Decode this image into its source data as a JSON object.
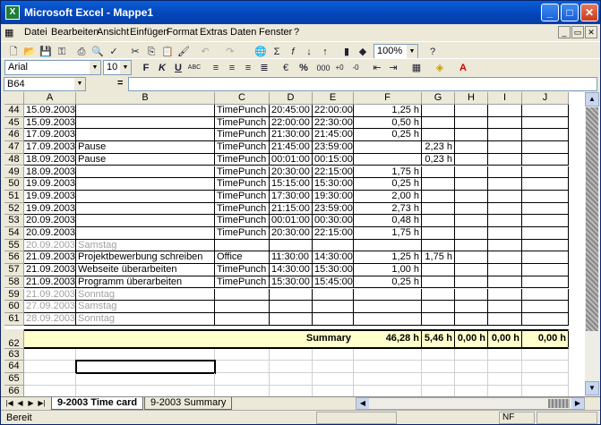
{
  "window": {
    "title": "Microsoft Excel - Mappe1",
    "app_icon": "X"
  },
  "menu": [
    "Datei",
    "Bearbeiten",
    "Ansicht",
    "Einfügen",
    "Format",
    "Extras",
    "Daten",
    "Fenster",
    "?"
  ],
  "toolbar": {
    "zoom": "100%",
    "font": "Arial",
    "size": "10",
    "bold": "F",
    "italic": "K",
    "underline": "U",
    "currency": "€",
    "percent": "%",
    "thousands": "000"
  },
  "formula": {
    "namebox": "B64",
    "eq": "=",
    "content": ""
  },
  "columns": [
    "A",
    "B",
    "C",
    "D",
    "E",
    "F",
    "G",
    "H",
    "I",
    "J"
  ],
  "rows": [
    {
      "n": "44",
      "a": "15.09.2003",
      "b": "",
      "c": "TimePunch",
      "d": "20:45:00",
      "e": "22:00:00",
      "f": "1,25 h",
      "g": "",
      "gray": false
    },
    {
      "n": "45",
      "a": "15.09.2003",
      "b": "",
      "c": "TimePunch",
      "d": "22:00:00",
      "e": "22:30:00",
      "f": "0,50 h",
      "g": "",
      "gray": false
    },
    {
      "n": "46",
      "a": "17.09.2003",
      "b": "",
      "c": "TimePunch",
      "d": "21:30:00",
      "e": "21:45:00",
      "f": "0,25 h",
      "g": "",
      "gray": false
    },
    {
      "n": "47",
      "a": "17.09.2003",
      "b": "Pause",
      "c": "TimePunch",
      "d": "21:45:00",
      "e": "23:59:00",
      "f": "",
      "g": "2,23 h",
      "gray": false
    },
    {
      "n": "48",
      "a": "18.09.2003",
      "b": "Pause",
      "c": "TimePunch",
      "d": "00:01:00",
      "e": "00:15:00",
      "f": "",
      "g": "0,23 h",
      "gray": false
    },
    {
      "n": "49",
      "a": "18.09.2003",
      "b": "",
      "c": "TimePunch",
      "d": "20:30:00",
      "e": "22:15:00",
      "f": "1,75 h",
      "g": "",
      "gray": false
    },
    {
      "n": "50",
      "a": "19.09.2003",
      "b": "",
      "c": "TimePunch",
      "d": "15:15:00",
      "e": "15:30:00",
      "f": "0,25 h",
      "g": "",
      "gray": false
    },
    {
      "n": "51",
      "a": "19.09.2003",
      "b": "",
      "c": "TimePunch",
      "d": "17:30:00",
      "e": "19:30:00",
      "f": "2,00 h",
      "g": "",
      "gray": false
    },
    {
      "n": "52",
      "a": "19.09.2003",
      "b": "",
      "c": "TimePunch",
      "d": "21:15:00",
      "e": "23:59:00",
      "f": "2,73 h",
      "g": "",
      "gray": false
    },
    {
      "n": "53",
      "a": "20.09.2003",
      "b": "",
      "c": "TimePunch",
      "d": "00:01:00",
      "e": "00:30:00",
      "f": "0,48 h",
      "g": "",
      "gray": false
    },
    {
      "n": "54",
      "a": "20.09.2003",
      "b": "",
      "c": "TimePunch",
      "d": "20:30:00",
      "e": "22:15:00",
      "f": "1,75 h",
      "g": "",
      "gray": false
    },
    {
      "n": "55",
      "a": "20.09.2003",
      "b": "Samstag",
      "c": "",
      "d": "",
      "e": "",
      "f": "",
      "g": "",
      "gray": true
    },
    {
      "n": "56",
      "a": "21.09.2003",
      "b": "Projektbewerbung schreiben",
      "c": "Office",
      "d": "11:30:00",
      "e": "14:30:00",
      "f": "1,25 h",
      "g": "1,75 h",
      "gray": false
    },
    {
      "n": "57",
      "a": "21.09.2003",
      "b": "Webseite überarbeiten",
      "c": "TimePunch",
      "d": "14:30:00",
      "e": "15:30:00",
      "f": "1,00 h",
      "g": "",
      "gray": false
    },
    {
      "n": "58",
      "a": "21.09.2003",
      "b": "Programm überarbeiten",
      "c": "TimePunch",
      "d": "15:30:00",
      "e": "15:45:00",
      "f": "0,25 h",
      "g": "",
      "gray": false
    },
    {
      "n": "59",
      "a": "21.09.2003",
      "b": "Sonntag",
      "c": "",
      "d": "",
      "e": "",
      "f": "",
      "g": "",
      "gray": true
    },
    {
      "n": "60",
      "a": "27.09.2003",
      "b": "Samstag",
      "c": "",
      "d": "",
      "e": "",
      "f": "",
      "g": "",
      "gray": true
    },
    {
      "n": "61",
      "a": "28.09.2003",
      "b": "Sonntag",
      "c": "",
      "d": "",
      "e": "",
      "f": "",
      "g": "",
      "gray": true
    }
  ],
  "summary": {
    "n": "62",
    "label": "Summary",
    "f": "46,28 h",
    "g": "5,46 h",
    "h": "0,00 h",
    "i": "0,00 h",
    "j": "0,00 h"
  },
  "empty_rows": [
    "63",
    "64",
    "65",
    "66"
  ],
  "sheets": [
    "9-2003 Time card",
    "9-2003 Summary"
  ],
  "status": {
    "text": "Bereit",
    "nf": "NF"
  }
}
